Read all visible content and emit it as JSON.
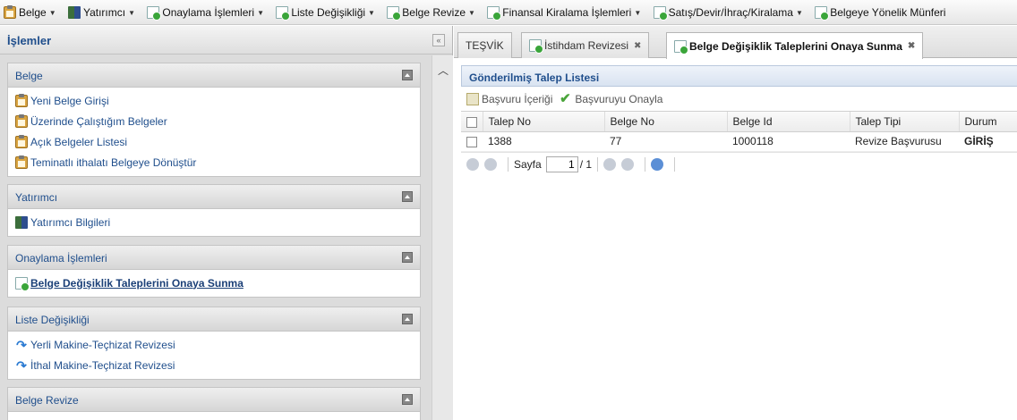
{
  "menu": [
    {
      "label": "Belge",
      "icon": "clipboard-icon"
    },
    {
      "label": "Yatırımcı",
      "icon": "building-icon"
    },
    {
      "label": "Onaylama İşlemleri",
      "icon": "document-icon"
    },
    {
      "label": "Liste Değişikliği",
      "icon": "document-icon"
    },
    {
      "label": "Belge Revize",
      "icon": "document-icon"
    },
    {
      "label": "Finansal Kiralama İşlemleri",
      "icon": "document-icon"
    },
    {
      "label": "Satış/Devir/İhraç/Kiralama",
      "icon": "document-icon"
    },
    {
      "label": "Belgeye Yönelik Münferi",
      "icon": "document-icon"
    }
  ],
  "left": {
    "title": "İşlemler",
    "sections": [
      {
        "title": "Belge",
        "items": [
          "Yeni Belge Girişi",
          "Üzerinde Çalıştığım Belgeler",
          "Açık Belgeler Listesi",
          "Teminatlı ithalatı Belgeye Dönüştür"
        ]
      },
      {
        "title": "Yatırımcı",
        "items": [
          "Yatırımcı Bilgileri"
        ]
      },
      {
        "title": "Onaylama İşlemleri",
        "items": [
          "Belge Değişiklik Taleplerini Onaya Sunma"
        ]
      },
      {
        "title": "Liste Değişikliği",
        "items": [
          "Yerli Makine-Teçhizat Revizesi",
          "İthal Makine-Teçhizat Revizesi"
        ]
      },
      {
        "title": "Belge Revize",
        "items": []
      }
    ]
  },
  "tabs": [
    {
      "label": "TEŞVİK",
      "closable": false,
      "active": false
    },
    {
      "label": "İstihdam Revizesi",
      "closable": true,
      "active": false
    },
    {
      "label": "Belge Değişiklik Taleplerini Onaya Sunma",
      "closable": true,
      "active": true
    }
  ],
  "grid": {
    "title": "Gönderilmiş Talep Listesi",
    "toolbar": {
      "view_label": "Başvuru İçeriği",
      "approve_label": "Başvuruyu Onayla"
    },
    "columns": [
      "Talep No",
      "Belge No",
      "Belge Id",
      "Talep Tipi",
      "Durum"
    ],
    "rows": [
      [
        "1388",
        "77",
        "1000118",
        "Revize Başvurusu",
        "GİRİŞ"
      ]
    ],
    "pager": {
      "page_label": "Sayfa",
      "current_page": "1",
      "total": "/ 1"
    }
  },
  "colors": {
    "link": "#1f4e8c",
    "accent_green": "#3aa53a"
  }
}
